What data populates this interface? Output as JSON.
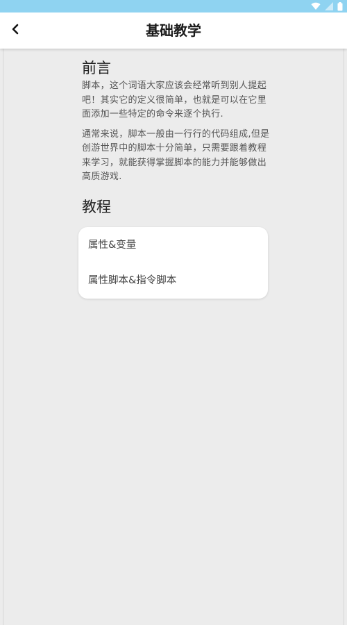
{
  "status_bar": {
    "icons": [
      "wifi-icon",
      "signal-icon",
      "battery-icon"
    ]
  },
  "header": {
    "back_icon": "chevron-left-icon",
    "title": "基础教学"
  },
  "preface": {
    "title": "前言",
    "paragraph_1": "脚本，这个词语大家应该会经常听到别人提起吧！其实它的定义很简单，也就是可以在它里面添加一些特定的命令来逐个执行.",
    "paragraph_2": "通常来说，脚本一般由一行行的代码组成,但是创游世界中的脚本十分简单，只需要跟着教程来学习，就能获得掌握脚本的能力并能够做出高质游戏."
  },
  "tutorial": {
    "title": "教程",
    "items": [
      {
        "label": "属性&变量"
      },
      {
        "label": "属性脚本&指令脚本"
      }
    ]
  },
  "colors": {
    "status_bar": "#8fd3f1",
    "background": "#ececec",
    "card": "#ffffff"
  }
}
